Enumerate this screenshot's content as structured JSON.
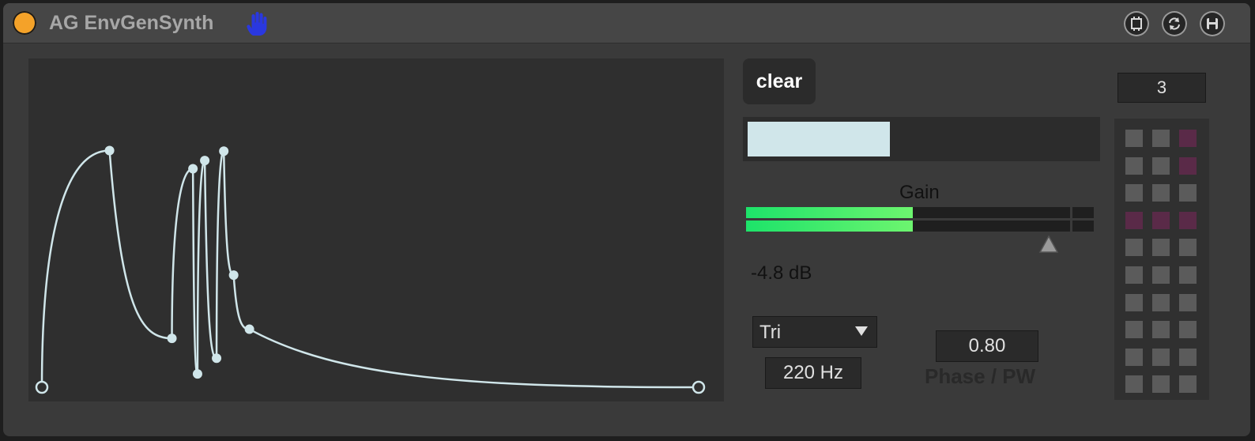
{
  "header": {
    "title": "AG EnvGenSynth",
    "power_color": "#f4a229",
    "hand_icon_color": "#2a38e0",
    "buttons": [
      {
        "name": "presentation-toggle-button",
        "icon": "freeze-icon"
      },
      {
        "name": "refresh-button",
        "icon": "refresh-icon"
      },
      {
        "name": "save-button",
        "icon": "save-icon"
      }
    ]
  },
  "envelope": {
    "line_color": "#d0e6ea",
    "points": [
      {
        "x": 0.0,
        "y": 0.0
      },
      {
        "x": 0.103,
        "y": 0.832
      },
      {
        "x": 0.198,
        "y": 0.172
      },
      {
        "x": 0.23,
        "y": 0.768
      },
      {
        "x": 0.237,
        "y": 0.047
      },
      {
        "x": 0.248,
        "y": 0.797
      },
      {
        "x": 0.266,
        "y": 0.102
      },
      {
        "x": 0.277,
        "y": 0.83
      },
      {
        "x": 0.292,
        "y": 0.394
      },
      {
        "x": 0.316,
        "y": 0.204
      },
      {
        "x": 1.0,
        "y": 0.0
      }
    ]
  },
  "controls": {
    "clear_label": "clear",
    "slider_value": 0.41,
    "gain_label": "Gain",
    "meter_level": 0.48,
    "db_value": "-4.8 dB",
    "waveform": "Tri",
    "frequency": "220 Hz",
    "phase_value": "0.80",
    "phase_label": "Phase / PW",
    "number_box": "3"
  },
  "matrix": {
    "active_color": "#5a2a48",
    "off_color": "#5b5b5b",
    "rows": [
      [
        0,
        0,
        1
      ],
      [
        0,
        0,
        1
      ],
      [
        0,
        0,
        0
      ],
      [
        1,
        1,
        1
      ],
      [
        0,
        0,
        0
      ],
      [
        0,
        0,
        0
      ],
      [
        0,
        0,
        0
      ],
      [
        0,
        0,
        0
      ],
      [
        0,
        0,
        0
      ],
      [
        0,
        0,
        0
      ]
    ]
  }
}
